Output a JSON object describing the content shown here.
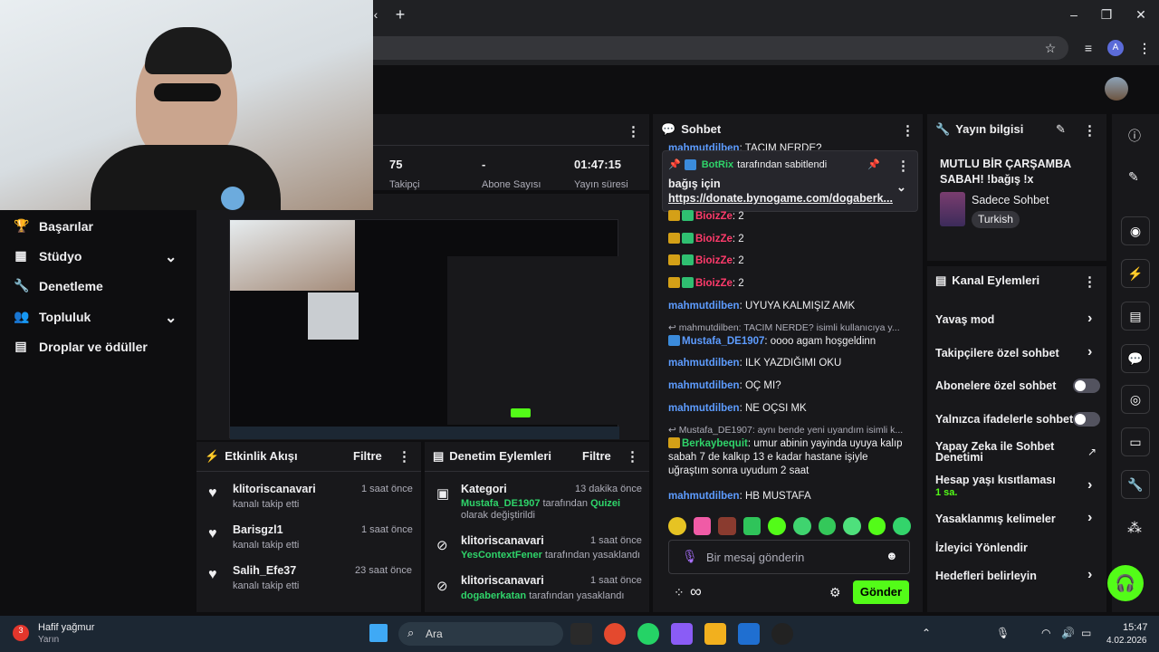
{
  "browser": {
    "new_tab": "+",
    "close_tab": "✕"
  },
  "nav": {
    "items": [
      {
        "label": "Başarılar",
        "icon": "trophy-icon",
        "has_chevron": false
      },
      {
        "label": "Stüdyo",
        "icon": "studio-icon",
        "has_chevron": true
      },
      {
        "label": "Denetleme",
        "icon": "wrench-icon",
        "has_chevron": false
      },
      {
        "label": "Topluluk",
        "icon": "community-icon",
        "has_chevron": true
      },
      {
        "label": "Droplar ve ödüller",
        "icon": "gift-icon",
        "has_chevron": false
      }
    ]
  },
  "stats": {
    "viewers": "75",
    "viewers_label": "Takipçi",
    "subs": "-",
    "subs_label": "Abone Sayısı",
    "uptime": "01:47:15",
    "uptime_label": "Yayın süresi"
  },
  "chat": {
    "title": "Sohbet",
    "pinned_by_name": "BotRix",
    "pinned_by_text": "tarafından sabitlendi",
    "pinned_msg_line1": "bağış için",
    "pinned_msg_link": "https://donate.bynogame.com/dogaberk...",
    "top_cut_user": "mahmutdilben",
    "top_cut_text": ": TACIM NERDE?",
    "messages": [
      {
        "user": "BioizZe",
        "text": ": 2",
        "color": "red",
        "badges": 2
      },
      {
        "user": "BioizZe",
        "text": ": 2",
        "color": "red",
        "badges": 2
      },
      {
        "user": "BioizZe",
        "text": ": 2",
        "color": "red",
        "badges": 2
      },
      {
        "user": "BioizZe",
        "text": ": 2",
        "color": "red",
        "badges": 2
      },
      {
        "user": "mahmutdilben",
        "text": ": UYUYA KALMIŞIZ AMK",
        "color": "blue",
        "badges": 0
      }
    ],
    "reply1": "↩ mahmutdilben: TACIM NERDE? isimli kullanıcıya y...",
    "msg_mustafa_user": "Mustafa_DE1907",
    "msg_mustafa_text": ": oooo agam hoşgeldinn",
    "msg_ilk_user": "mahmutdilben",
    "msg_ilk_text": ": ILK YAZDIĞIMI OKU",
    "msg_oc_user": "mahmutdilben",
    "msg_oc_text": ": OÇ MI?",
    "msg_ne_user": "mahmutdilben",
    "msg_ne_text": ": NE OÇSI MK",
    "reply2": "↩ Mustafa_DE1907: aynı bende yeni uyandım isimli k...",
    "msg_berk_user": "Berkaybequit",
    "msg_berk_text": ": umur abinin yayinda uyuya kalıp sabah 7 de kalkıp 13 e kadar hastane işiyle uğraştım sonra uyudum 2 saat",
    "msg_hb_user": "mahmutdilben",
    "msg_hb_text": ": HB MUSTAFA",
    "input_placeholder": "Bir mesaj gönderin",
    "send_label": "Gönder",
    "infinity": "∞"
  },
  "stream_info": {
    "title": "Yayın bilgisi",
    "stream_title": "MUTLU BİR ÇARŞAMBA SABAH! !bağış !x",
    "category": "Sadece Sohbet",
    "tag": "Turkish"
  },
  "channel_actions": {
    "title": "Kanal Eylemleri",
    "items": [
      {
        "label": "Yavaş mod",
        "control": "chevron"
      },
      {
        "label": "Takipçilere özel sohbet",
        "control": "chevron"
      },
      {
        "label": "Abonelere özel sohbet",
        "control": "toggle"
      },
      {
        "label": "Yalnızca ifadelerle sohbet",
        "control": "toggle"
      },
      {
        "label": "Yapay Zeka ile Sohbet Denetimi",
        "control": "external"
      },
      {
        "label": "Hesap yaşı kısıtlaması",
        "sub": "1 sa.",
        "control": "chevron"
      },
      {
        "label": "Yasaklanmış kelimeler",
        "control": "chevron"
      },
      {
        "label": "İzleyici Yönlendir",
        "control": "none"
      },
      {
        "label": "Hedefleri belirleyin",
        "control": "chevron"
      }
    ]
  },
  "activity": {
    "title": "Etkinlik Akışı",
    "filter": "Filtre",
    "items": [
      {
        "user": "klitoriscanavari",
        "action": "kanalı takip etti",
        "time": "1 saat önce"
      },
      {
        "user": "Barisgzl1",
        "action": "kanalı takip etti",
        "time": "1 saat önce"
      },
      {
        "user": "Salih_Efe37",
        "action": "kanalı takip etti",
        "time": "23 saat önce"
      }
    ]
  },
  "mod_actions": {
    "title": "Denetim Eylemleri",
    "filter": "Filtre",
    "items": [
      {
        "title": "Kategori",
        "time": "13 dakika önce",
        "actor": "Mustafa_DE1907",
        "mid": " tarafından ",
        "target": "Quizei",
        "tail": " olarak değiştirildi"
      },
      {
        "title": "klitoriscanavari",
        "time": "1 saat önce",
        "actor": "YesContextFener",
        "mid": " tarafından yasaklandı",
        "target": "",
        "tail": ""
      },
      {
        "title": "klitoriscanavari",
        "time": "1 saat önce",
        "actor": "dogaberkatan",
        "mid": " tarafından yasaklandı",
        "target": "",
        "tail": ""
      }
    ]
  },
  "taskbar": {
    "weather_title": "Hafif yağmur",
    "weather_sub": "Yarın",
    "weather_badge": "3",
    "search": "Ara",
    "time": "15:47",
    "date": "4.02.2026"
  },
  "colors": {
    "accent_green": "#53fc18",
    "chat_blue": "#5d9cff",
    "chat_red": "#ff3b6b"
  }
}
